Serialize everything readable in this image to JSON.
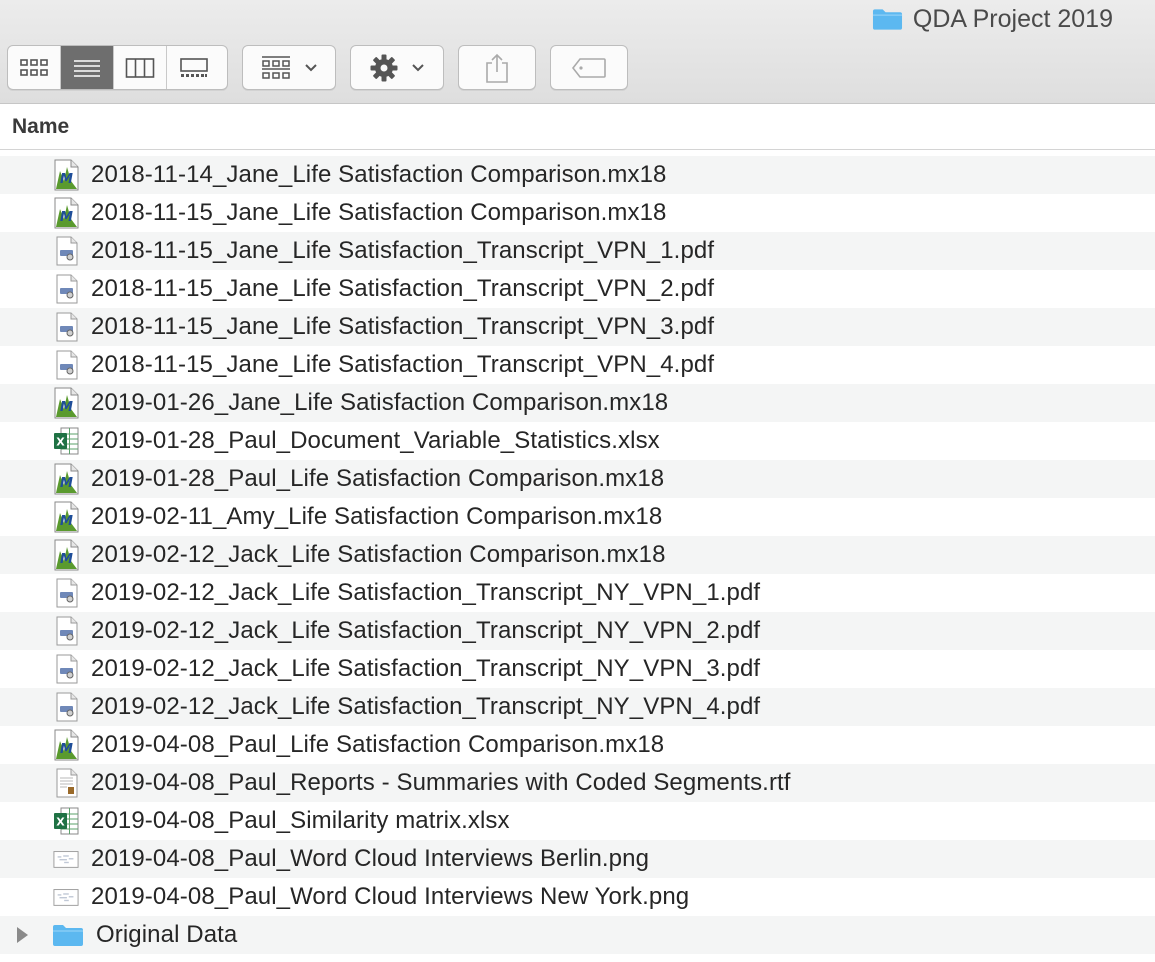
{
  "window": {
    "title": "QDA Project 2019",
    "title_icon": "folder-icon"
  },
  "toolbar": {
    "view_modes": [
      {
        "name": "icon-view",
        "icon": "grid-icon",
        "active": false
      },
      {
        "name": "list-view",
        "icon": "list-icon",
        "active": true
      },
      {
        "name": "column-view",
        "icon": "columns-icon",
        "active": false
      },
      {
        "name": "gallery-view",
        "icon": "gallery-icon",
        "active": false
      }
    ],
    "group_button_icon": "group-grid-icon",
    "action_button_icon": "gear-icon",
    "share_button_icon": "share-icon",
    "tag_button_icon": "tag-icon"
  },
  "columns": {
    "name": "Name"
  },
  "files": [
    {
      "name": "2018-11-14_Jane_Life Satisfaction Comparison.mx18",
      "type": "mx18"
    },
    {
      "name": "2018-11-15_Jane_Life Satisfaction Comparison.mx18",
      "type": "mx18"
    },
    {
      "name": "2018-11-15_Jane_Life Satisfaction_Transcript_VPN_1.pdf",
      "type": "pdf"
    },
    {
      "name": "2018-11-15_Jane_Life Satisfaction_Transcript_VPN_2.pdf",
      "type": "pdf"
    },
    {
      "name": "2018-11-15_Jane_Life Satisfaction_Transcript_VPN_3.pdf",
      "type": "pdf"
    },
    {
      "name": "2018-11-15_Jane_Life Satisfaction_Transcript_VPN_4.pdf",
      "type": "pdf"
    },
    {
      "name": "2019-01-26_Jane_Life Satisfaction Comparison.mx18",
      "type": "mx18"
    },
    {
      "name": "2019-01-28_Paul_Document_Variable_Statistics.xlsx",
      "type": "xlsx"
    },
    {
      "name": "2019-01-28_Paul_Life Satisfaction Comparison.mx18",
      "type": "mx18"
    },
    {
      "name": "2019-02-11_Amy_Life Satisfaction Comparison.mx18",
      "type": "mx18"
    },
    {
      "name": "2019-02-12_Jack_Life Satisfaction Comparison.mx18",
      "type": "mx18"
    },
    {
      "name": "2019-02-12_Jack_Life Satisfaction_Transcript_NY_VPN_1.pdf",
      "type": "pdf"
    },
    {
      "name": "2019-02-12_Jack_Life Satisfaction_Transcript_NY_VPN_2.pdf",
      "type": "pdf"
    },
    {
      "name": "2019-02-12_Jack_Life Satisfaction_Transcript_NY_VPN_3.pdf",
      "type": "pdf"
    },
    {
      "name": "2019-02-12_Jack_Life Satisfaction_Transcript_NY_VPN_4.pdf",
      "type": "pdf"
    },
    {
      "name": "2019-04-08_Paul_Life Satisfaction Comparison.mx18",
      "type": "mx18"
    },
    {
      "name": "2019-04-08_Paul_Reports - Summaries with Coded Segments.rtf",
      "type": "rtf"
    },
    {
      "name": "2019-04-08_Paul_Similarity matrix.xlsx",
      "type": "xlsx"
    },
    {
      "name": "2019-04-08_Paul_Word Cloud Interviews Berlin.png",
      "type": "png"
    },
    {
      "name": "2019-04-08_Paul_Word Cloud Interviews New York.png",
      "type": "png"
    }
  ],
  "folders": [
    {
      "name": "Original Data",
      "expanded": false
    }
  ],
  "colors": {
    "folder_blue": "#5cb8f0",
    "maxqda_green": "#5a9a2e",
    "excel_green": "#1f7244",
    "active_segment": "#6e6e6e",
    "alt_row": "#f4f5f5"
  }
}
